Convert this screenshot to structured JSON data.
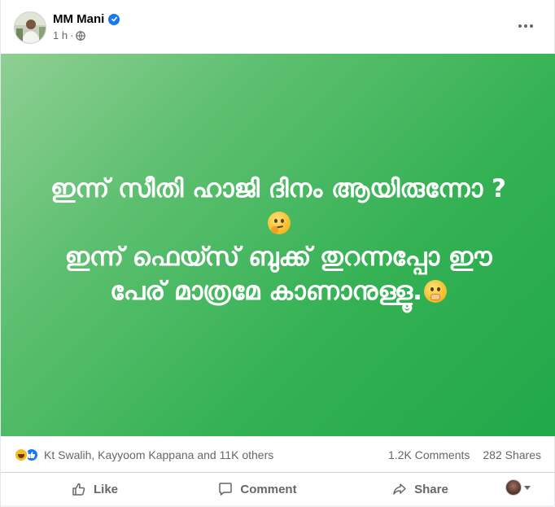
{
  "post": {
    "author": "MM Mani",
    "time": "1 h",
    "separator": "·",
    "audience_icon": "globe-icon",
    "verified_icon": "verified-badge-icon",
    "more_icon": "more-options-icon",
    "text_lines": [
      "ഇന്ന് സീതി ഹാജി ദിനം ആയിരുന്നോ ?",
      "ഇന്ന് ഫെയ്സ് ബുക്ക് തുറന്നപ്പോ ഈ",
      "പേര് മാത്രമേ കാണാനുള്ളൂ."
    ],
    "emojis": [
      "thinking-face-emoji",
      "face-with-hand-over-mouth-emoji"
    ],
    "background_colors": [
      "#8fcf93",
      "#20a84a"
    ]
  },
  "reactions": {
    "icons": [
      "haha-reaction-icon",
      "like-reaction-icon"
    ],
    "summary": "Kt Swalih, Kayyoom Kappana and 11K others",
    "comments": "1.2K Comments",
    "shares": "282 Shares"
  },
  "actions": {
    "like_label": "Like",
    "comment_label": "Comment",
    "share_label": "Share"
  },
  "colors": {
    "accent": "#1877f2",
    "secondary_text": "#65676b"
  }
}
